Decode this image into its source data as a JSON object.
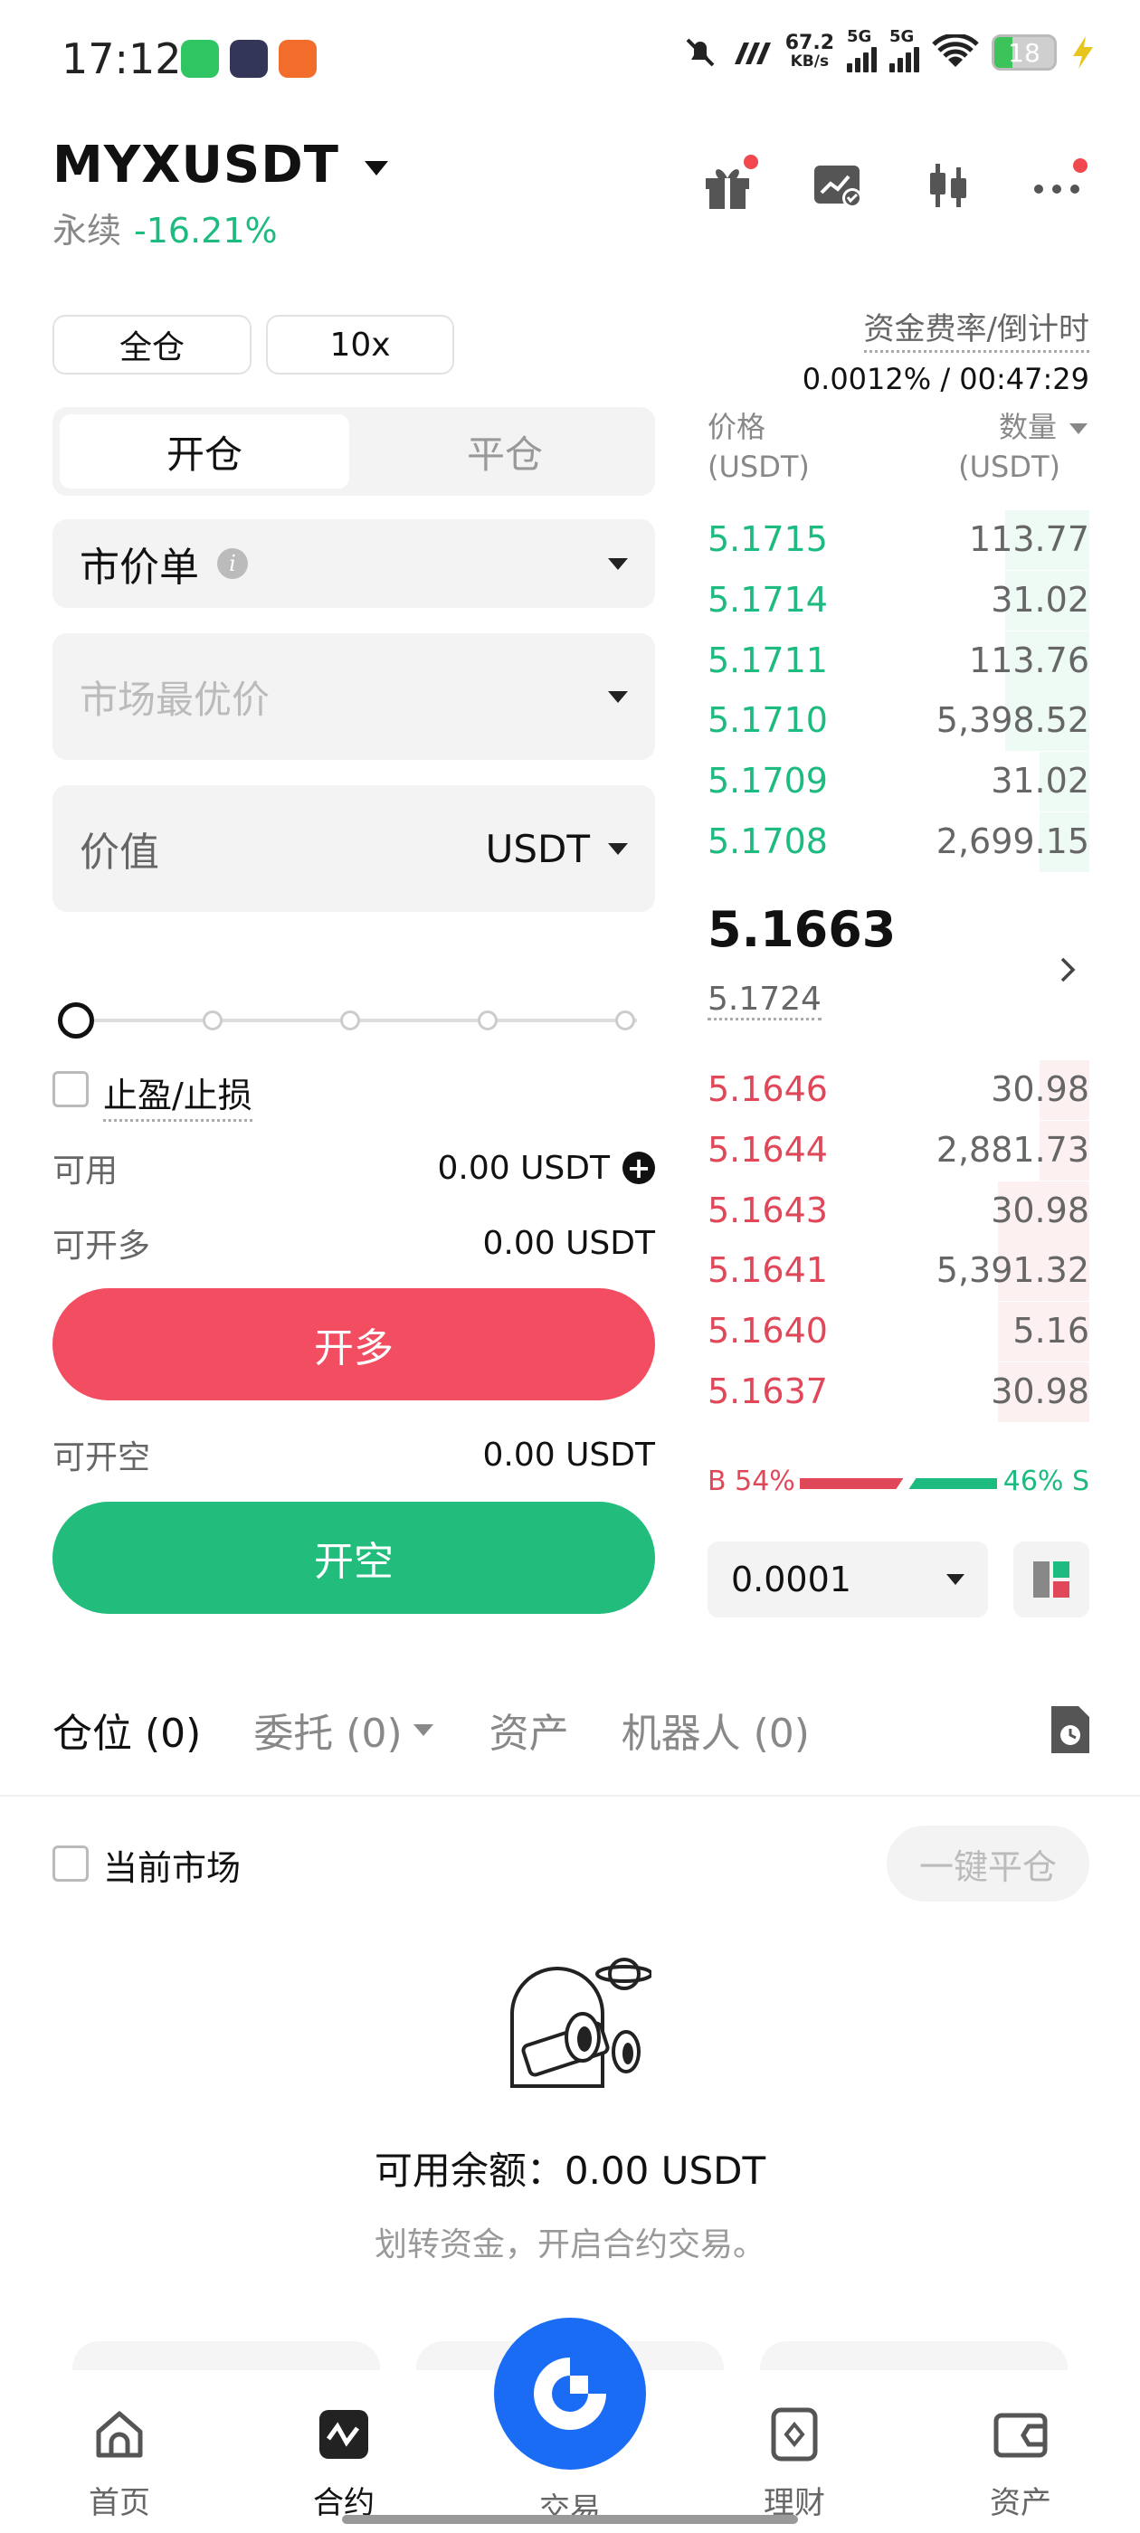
{
  "status_bar": {
    "time": "17:12",
    "net_speed_value": "67.2",
    "net_speed_unit": "KB/s",
    "sig1": "5G",
    "sig2": "5G",
    "battery": "18"
  },
  "header": {
    "symbol": "MYXUSDT",
    "type": "永续",
    "change": "-16.21%"
  },
  "controls": {
    "margin_mode": "全仓",
    "leverage": "10x",
    "funding_label": "资金费率/倒计时",
    "funding_value": "0.0012% / 00:47:29"
  },
  "order_form": {
    "tab_open": "开仓",
    "tab_close": "平仓",
    "order_type": "市价单",
    "price_placeholder": "市场最优价",
    "value_label": "价值",
    "value_unit": "USDT",
    "slider_percent": 0,
    "tpsl_label": "止盈/止损",
    "available_label": "可用",
    "available_value": "0.00 USDT",
    "long_label": "可开多",
    "long_value": "0.00 USDT",
    "open_long": "开多",
    "short_label": "可开空",
    "short_value": "0.00 USDT",
    "open_short": "开空"
  },
  "orderbook": {
    "col_price": "价格",
    "col_price_unit": "(USDT)",
    "col_qty": "数量",
    "col_qty_unit": "(USDT)",
    "asks": [
      {
        "price": "5.1715",
        "qty": "113.77",
        "depth": 0.22
      },
      {
        "price": "5.1714",
        "qty": "31.02",
        "depth": 0.22
      },
      {
        "price": "5.1711",
        "qty": "113.76",
        "depth": 0.22
      },
      {
        "price": "5.1710",
        "qty": "5,398.52",
        "depth": 0.22
      },
      {
        "price": "5.1709",
        "qty": "31.02",
        "depth": 0.13
      },
      {
        "price": "5.1708",
        "qty": "2,699.15",
        "depth": 0.13
      }
    ],
    "last_price": "5.1663",
    "mark_price": "5.1724",
    "bids": [
      {
        "price": "5.1646",
        "qty": "30.98",
        "depth": 0.13
      },
      {
        "price": "5.1644",
        "qty": "2,881.73",
        "depth": 0.13
      },
      {
        "price": "5.1643",
        "qty": "30.98",
        "depth": 0.24
      },
      {
        "price": "5.1641",
        "qty": "5,391.32",
        "depth": 0.24
      },
      {
        "price": "5.1640",
        "qty": "5.16",
        "depth": 0.24
      },
      {
        "price": "5.1637",
        "qty": "30.98",
        "depth": 0.24
      }
    ],
    "buy_label": "B 54%",
    "sell_label": "46% S",
    "buy_ratio": 0.54,
    "precision": "0.0001"
  },
  "colors": {
    "up": "#1dbb7f",
    "down": "#e0485a",
    "long_btn": "#f24d60",
    "short_btn": "#22bd7d",
    "brand": "#1a6cf5"
  },
  "tabs": {
    "positions": "仓位 (0)",
    "orders": "委托 (0)",
    "assets": "资产",
    "bots": "机器人 (0)"
  },
  "positions": {
    "current_market": "当前市场",
    "close_all": "一键平仓",
    "balance": "可用余额：0.00 USDT",
    "hint": "划转资金，开启合约交易。"
  },
  "nav": {
    "home": "首页",
    "futures": "合约",
    "trade": "交易",
    "earn": "理财",
    "assets": "资产"
  }
}
